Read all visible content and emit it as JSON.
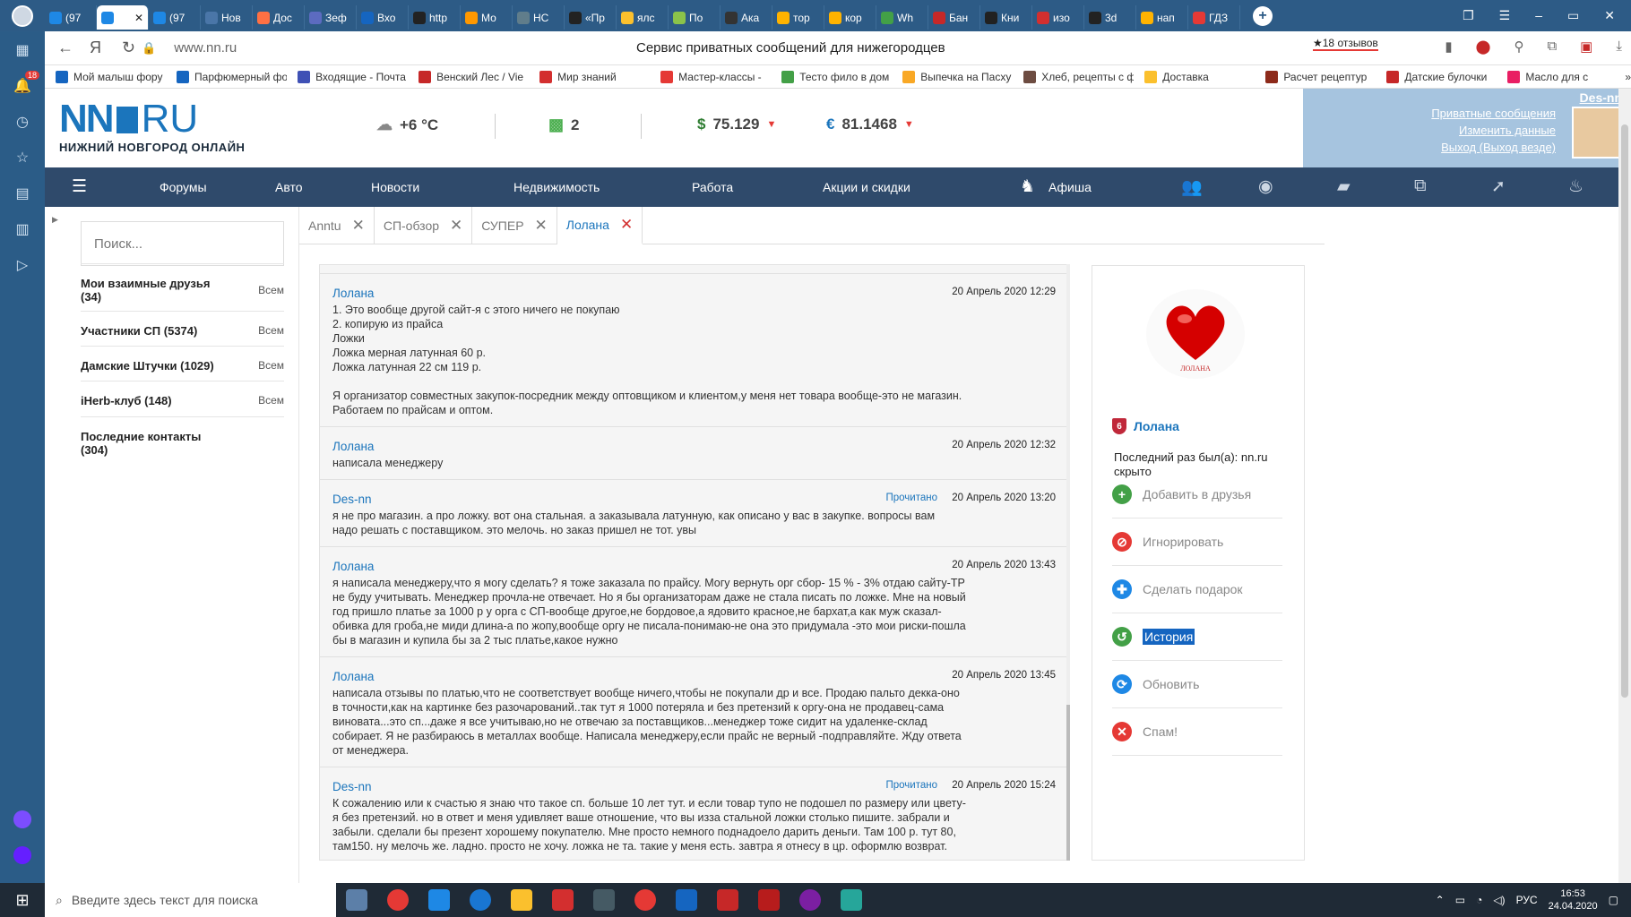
{
  "browser": {
    "tabs": [
      {
        "label": "(97",
        "color": "#1e88e5"
      },
      {
        "label": "",
        "color": "#1e88e5",
        "active": true
      },
      {
        "label": "(97",
        "color": "#1e88e5"
      },
      {
        "label": "Нов",
        "color": "#4a76a8"
      },
      {
        "label": "Дос",
        "color": "#ff7043"
      },
      {
        "label": "Зеф",
        "color": "#5c6bc0"
      },
      {
        "label": "Вхо",
        "color": "#1565c0"
      },
      {
        "label": "http",
        "color": "#222222"
      },
      {
        "label": "Мо",
        "color": "#ff9800"
      },
      {
        "label": "НС",
        "color": "#607d8b"
      },
      {
        "label": "«Пр",
        "color": "#222222"
      },
      {
        "label": "ялс",
        "color": "#fbc02d"
      },
      {
        "label": "По",
        "color": "#8bc34a"
      },
      {
        "label": "Ака",
        "color": "#333333"
      },
      {
        "label": "тор",
        "color": "#ffb300"
      },
      {
        "label": "кор",
        "color": "#ffb300"
      },
      {
        "label": "Wh",
        "color": "#43a047"
      },
      {
        "label": "Бан",
        "color": "#c62828"
      },
      {
        "label": "Кни",
        "color": "#212121"
      },
      {
        "label": "изо",
        "color": "#d32f2f"
      },
      {
        "label": "3d",
        "color": "#222222"
      },
      {
        "label": "нап",
        "color": "#ffb300"
      },
      {
        "label": "ГДЗ",
        "color": "#e53935"
      }
    ],
    "url": "www.nn.ru",
    "page_title": "Сервис приватных сообщений для нижегородцев",
    "reviews": "★18 отзывов",
    "sidebar_badge": "18",
    "bookmarks": [
      {
        "label": "Мой малыш фору",
        "color": "#1565c0"
      },
      {
        "label": "Парфюмерный фо",
        "color": "#1565c0"
      },
      {
        "label": "Входящие - Почта",
        "color": "#3f51b5"
      },
      {
        "label": "Венский Лес / Vie",
        "color": "#c62828"
      },
      {
        "label": "Мир знаний",
        "color": "#d32f2f"
      },
      {
        "label": "Мастер-классы -",
        "color": "#e53935"
      },
      {
        "label": "Тесто фило в дом",
        "color": "#43a047"
      },
      {
        "label": "Выпечка на Пасху",
        "color": "#f9a825"
      },
      {
        "label": "Хлеб, рецепты с ф",
        "color": "#6d4c41"
      },
      {
        "label": "Доставка",
        "color": "#fbc02d"
      },
      {
        "label": "Расчет рецептур",
        "color": "#8d2a1a"
      },
      {
        "label": "Датские булочки",
        "color": "#c62828"
      },
      {
        "label": "Масло для с",
        "color": "#e91e63"
      }
    ]
  },
  "site": {
    "logo_nn": "NN",
    "logo_ru": "RU",
    "logo_sub": "НИЖНИЙ НОВГОРОД ОНЛАЙН",
    "weather": "+6 °C",
    "traffic": "2",
    "usd": "75.129",
    "eur": "81.1468",
    "user": {
      "name": "Des-nn",
      "links": [
        "Приватные сообщения",
        "Изменить данные",
        "Выход (Выход везде)"
      ]
    },
    "nav": [
      "Форумы",
      "Авто",
      "Новости",
      "Недвижимость",
      "Работа",
      "Акции и скидки",
      "Афиша"
    ]
  },
  "left": {
    "search_placeholder": "Поиск...",
    "all_label": "Всем",
    "groups": [
      {
        "label": "Мои взаимные друзья (34)",
        "all": true
      },
      {
        "label": "Участники СП (5374)",
        "all": true
      },
      {
        "label": "Дамские Штучки (1029)",
        "all": true
      },
      {
        "label": "iHerb-клуб (148)",
        "all": true
      },
      {
        "label": "Последние контакты (304)",
        "all": false
      }
    ]
  },
  "conv_tabs": [
    {
      "label": "Anntu"
    },
    {
      "label": "СП-обзор"
    },
    {
      "label": "СУПЕР"
    },
    {
      "label": "Лолана",
      "active": true
    }
  ],
  "messages": [
    {
      "author": "Лолана",
      "date": "20 Апрель 2020 12:29",
      "read": "",
      "body": "1. Это вообще другой сайт-я с этого ничего не покупаю\n2. копирую из прайса\nЛожки\nЛожка мерная латунная 60 р.\nЛожка латунная 22 см 119 р.\n\nЯ организатор совместных закупок-посредник между оптовщиком и клиентом,у меня нет товара вообще-это не магазин.\nРаботаем по прайсам и оптом."
    },
    {
      "author": "Лолана",
      "date": "20 Апрель 2020 12:32",
      "read": "",
      "body": "написала менеджеру"
    },
    {
      "author": "Des-nn",
      "date": "20 Апрель 2020 13:20",
      "read": "Прочитано",
      "body": "я не про магазин. а про ложку. вот она стальная. а заказывала латунную, как описано у вас в закупке. вопросы вам\nнадо решать с поставщиком. это мелочь. но заказ пришел не тот. увы"
    },
    {
      "author": "Лолана",
      "date": "20 Апрель 2020 13:43",
      "read": "",
      "body": "я написала менеджеру,что я могу сделать? я тоже заказала по прайсу. Могу вернуть орг сбор- 15 % - 3% отдаю сайту-ТР\nне буду учитывать. Менеджер прочла-не отвечает. Но я бы организаторам даже не стала писать по ложке. Мне на новый\nгод пришло платье за 1000 р у орга с СП-вообще другое,не бордовое,а ядовито красное,не бархат,а как муж сказал-\nобивка для гроба,не миди длина-а по жопу,вообще оргу не писала-понимаю-не она это придумала -это мои риски-пошла\nбы в магазин и купила бы за 2 тыс платье,какое нужно"
    },
    {
      "author": "Лолана",
      "date": "20 Апрель 2020 13:45",
      "read": "",
      "body": "написала отзывы по платью,что не соответствует вообще ничего,чтобы не покупали др и все. Продаю пальто декка-оно\nв точности,как на картинке без разочарований..так тут я 1000 потеряла и без претензий к оргу-она не продавец-сама\nвиновата...это сп...даже я все учитываю,но не отвечаю за поставщиков...менеджер тоже сидит на удаленке-склад\nсобирает. Я не разбираюсь в металлах вообще. Написала менеджеру,если прайс не верный -подправляйте. Жду ответа\nот менеджера."
    },
    {
      "author": "Des-nn",
      "date": "20 Апрель 2020 15:24",
      "read": "Прочитано",
      "body": "К сожалению или к счастью я знаю что такое сп. больше 10 лет тут. и если товар тупо не подошел по размеру или цвету-\nя без претензий. но в ответ и меня удивляет ваше отношение, что вы изза стальной ложки столько пишите. забрали и\nзабыли. сделали бы презент хорошему покупателю. Мне просто немного поднадоело дарить деньги. Там 100 р. тут 80,\nтам150. ну мелочь же. ладно. просто не хочу. ложка не та. такие у меня есть. завтра я отнесу в цр. оформлю возврат."
    }
  ],
  "profile": {
    "avatar_text": "ЛОЛАНА",
    "level": "6",
    "name": "Лолана",
    "last_seen": "Последний раз был(а): nn.ru скрыто",
    "actions": [
      {
        "label": "Добавить в друзья",
        "icon": "plus-circle-icon",
        "color": "#43a047"
      },
      {
        "label": "Игнорировать",
        "icon": "ban-icon",
        "color": "#e53935"
      },
      {
        "label": "Сделать подарок",
        "icon": "gift-icon",
        "color": "#1e88e5"
      },
      {
        "label": "История",
        "icon": "history-icon",
        "color": "#43a047",
        "selected": true
      },
      {
        "label": "Обновить",
        "icon": "refresh-icon",
        "color": "#1e88e5"
      },
      {
        "label": "Спам!",
        "icon": "close-circle-icon",
        "color": "#e53935"
      }
    ]
  },
  "taskbar": {
    "search_placeholder": "Введите здесь текст для поиска",
    "lang": "РУС",
    "time": "16:53",
    "date": "24.04.2020"
  }
}
